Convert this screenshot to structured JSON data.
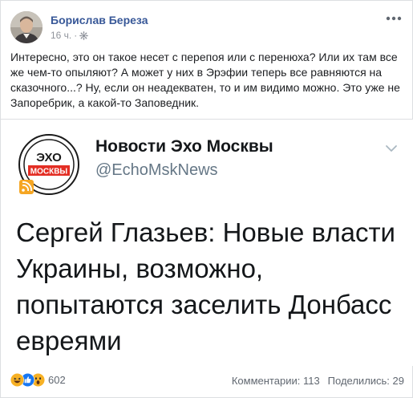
{
  "post": {
    "author": "Борислав Береза",
    "time": "16 ч.",
    "separator": "·",
    "text": "Интересно, это он такое несет с перепоя или с перенюха? Или их там все же чем-то опыляют? А может у них в Эрэфии теперь все равняются на сказочного...? Ну, если он неадекватен, то и им видимо можно. Это уже не Запоребрик, а какой-то Заповедник."
  },
  "embed": {
    "logo_top": "ЭХО",
    "logo_bottom": "МОСКВЫ",
    "name": "Новости Эхо Москвы",
    "handle": "@EchoMskNews",
    "body": "Сергей Глазьев: Новые власти Украины, возможно, попытаются заселить Донбасс евреями"
  },
  "footer": {
    "reaction_count": "602",
    "comments": "Комментарии: 113",
    "shares": "Поделились: 29",
    "reaction_icons": [
      "haha-icon",
      "like-icon",
      "wow-icon"
    ]
  },
  "colors": {
    "author_link": "#385898",
    "meta": "#90949c",
    "echo_red": "#e32e24",
    "rss_orange": "#f5a623",
    "like_blue": "#1877f2",
    "emoji_yellow": "#f7b125"
  }
}
